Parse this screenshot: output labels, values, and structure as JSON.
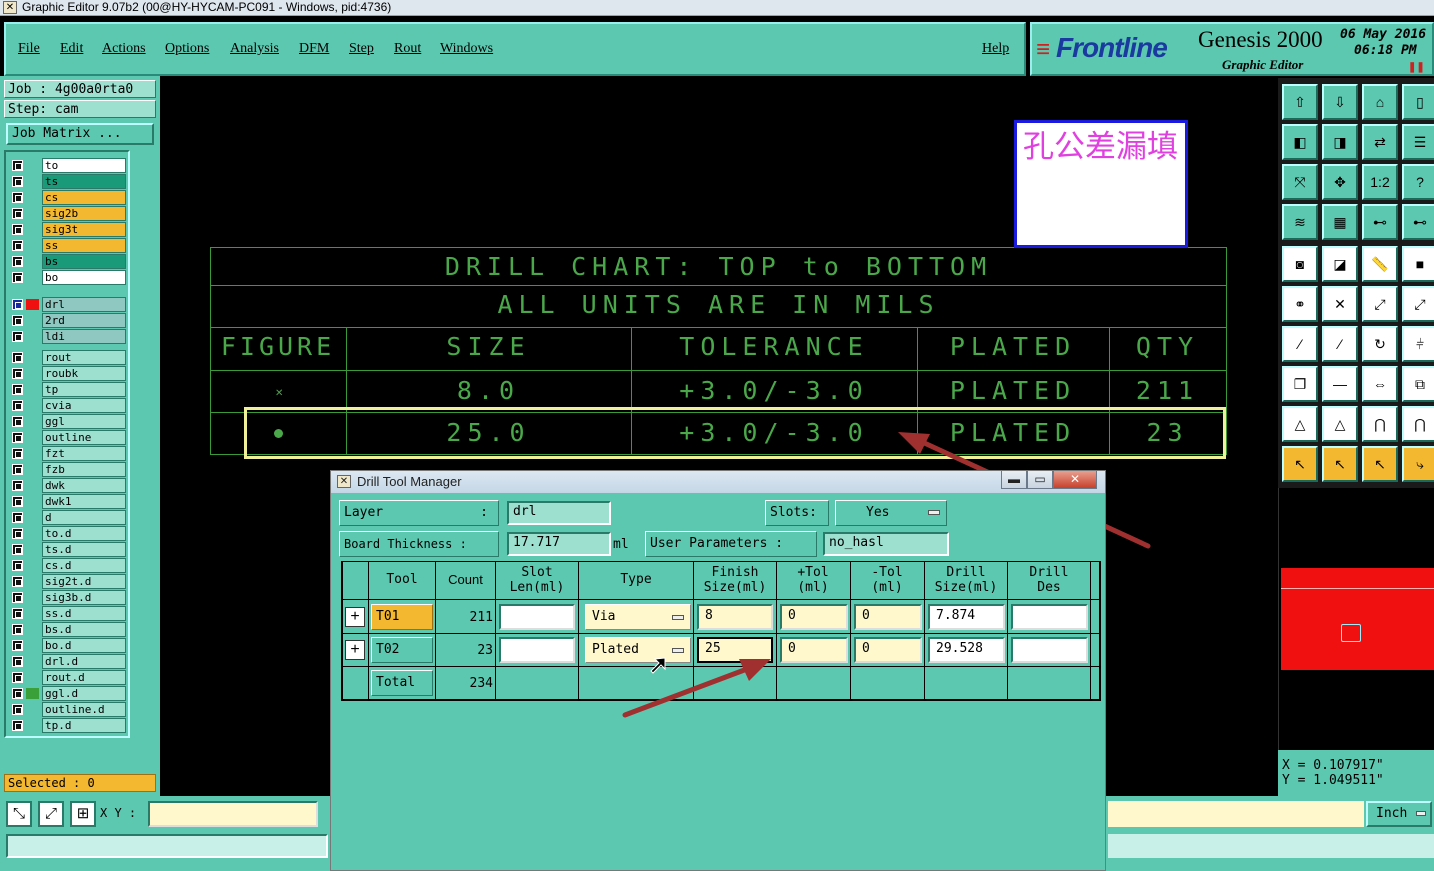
{
  "window": {
    "title": "Graphic Editor 9.07b2 (00@HY-HYCAM-PC091 - Windows, pid:4736)"
  },
  "menu": {
    "items": [
      "File",
      "Edit",
      "Actions",
      "Options",
      "Analysis",
      "DFM",
      "Step",
      "Rout",
      "Windows"
    ],
    "help": "Help"
  },
  "brand": {
    "logo": "Frontline",
    "product": "Genesis 2000",
    "subtitle": "Graphic Editor",
    "date": "06 May 2016",
    "time": "06:18 PM"
  },
  "job": {
    "job_label": "Job : 4g00a0rta0",
    "step_label": "Step: cam",
    "matrix_button": "Job Matrix ..."
  },
  "layers": {
    "group1": [
      "to",
      "ts",
      "cs",
      "sig2b",
      "sig3t",
      "ss",
      "bs",
      "bo"
    ],
    "group2": [
      "drl",
      "2rd",
      "ldi"
    ],
    "group3": [
      "rout",
      "roubk",
      "tp",
      "cvia",
      "ggl",
      "outline",
      "fzt",
      "fzb",
      "dwk",
      "dwk1",
      "d",
      "to.d",
      "ts.d",
      "cs.d",
      "sig2t.d",
      "sig3b.d",
      "ss.d",
      "bs.d",
      "bo.d",
      "drl.d",
      "rout.d",
      "ggl.d",
      "outline.d",
      "tp.d"
    ],
    "colors": {
      "to": "#ffffff",
      "ts": "#1a9a78",
      "cs": "#f4b830",
      "sig2b": "#f4b830",
      "sig3t": "#f4b830",
      "ss": "#f4b830",
      "bs": "#1a9a78",
      "bo": "#ffffff"
    }
  },
  "status": {
    "selected": "Selected : 0",
    "xy_label": "X Y :"
  },
  "note": {
    "text": "孔公差漏填"
  },
  "drill_chart": {
    "title1": "DRILL CHART: TOP to BOTTOM",
    "title2": "ALL UNITS ARE IN MILS",
    "headers": [
      "FIGURE",
      "SIZE",
      "TOLERANCE",
      "PLATED",
      "QTY"
    ],
    "rows": [
      {
        "size": "8.0",
        "tolerance": "+3.0/-3.0",
        "plated": "PLATED",
        "qty": "211"
      },
      {
        "size": "25.0",
        "tolerance": "+3.0/-3.0",
        "plated": "PLATED",
        "qty": "23"
      }
    ]
  },
  "coords": {
    "x": "X = 0.107917\"",
    "y": "Y = 1.049511\""
  },
  "units": {
    "value": "Inch"
  },
  "dialog": {
    "title": "Drill Tool Manager",
    "layer_label": "Layer",
    "layer_value": "drl",
    "slots_label": "Slots:",
    "slots_value": "Yes",
    "board_thickness_label": "Board Thickness :",
    "board_thickness_value": "17.717",
    "board_thickness_unit": "ml",
    "user_params_label": "User Parameters :",
    "user_params_value": "no_hasl",
    "columns": [
      "Tool",
      "Count",
      "Slot Len(ml)",
      "Type",
      "Finish Size(ml)",
      "+Tol (ml)",
      "-Tol (ml)",
      "Drill Size(ml)",
      "Drill Des"
    ],
    "rows": [
      {
        "tool": "T01",
        "count": "211",
        "slot": "",
        "type": "Via",
        "finish": "8",
        "ptol": "0",
        "mtol": "0",
        "drill": "7.874",
        "des": ""
      },
      {
        "tool": "T02",
        "count": "23",
        "slot": "",
        "type": "Plated",
        "finish": "25",
        "ptol": "0",
        "mtol": "0",
        "drill": "29.528",
        "des": ""
      }
    ],
    "total_label": "Total",
    "total_count": "234"
  }
}
